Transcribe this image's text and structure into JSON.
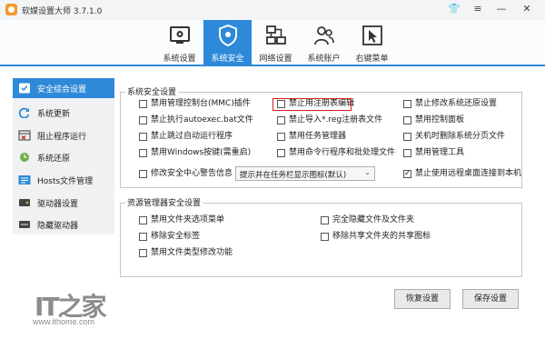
{
  "window": {
    "title": "软媒设置大师 3.7.1.0",
    "skin_glyph": "👕",
    "menu_glyph": "≡",
    "minimize_glyph": "—",
    "close_glyph": "✕"
  },
  "toolbar": {
    "items": [
      {
        "label": "系统设置",
        "icon": "system-settings-icon"
      },
      {
        "label": "系统安全",
        "icon": "shield-icon",
        "active": true
      },
      {
        "label": "网络设置",
        "icon": "network-icon"
      },
      {
        "label": "系统账户",
        "icon": "users-icon"
      },
      {
        "label": "右键菜单",
        "icon": "cursor-icon"
      }
    ]
  },
  "sidebar": {
    "items": [
      {
        "label": "安全综合设置",
        "icon": "shield-check-icon",
        "active": true
      },
      {
        "label": "系统更新",
        "icon": "refresh-icon"
      },
      {
        "label": "阻止程序运行",
        "icon": "block-icon"
      },
      {
        "label": "系统还原",
        "icon": "restore-icon"
      },
      {
        "label": "Hosts文件管理",
        "icon": "hosts-icon"
      },
      {
        "label": "驱动器设置",
        "icon": "drive-icon"
      },
      {
        "label": "隐藏驱动器",
        "icon": "hidden-drive-icon"
      }
    ]
  },
  "system_security": {
    "title": "系统安全设置",
    "options": [
      {
        "label": "禁用管理控制台(MMC)插件",
        "checked": false
      },
      {
        "label": "禁止用注册表编辑",
        "checked": false,
        "highlighted": true
      },
      {
        "label": "禁止修改系统还原设置",
        "checked": false
      },
      {
        "label": "禁止执行autoexec.bat文件",
        "checked": false
      },
      {
        "label": "禁止导入*.reg注册表文件",
        "checked": false
      },
      {
        "label": "禁用控制面板",
        "checked": false
      },
      {
        "label": "禁止跳过自动运行程序",
        "checked": false
      },
      {
        "label": "禁用任务管理器",
        "checked": false
      },
      {
        "label": "关机时删除系统分页文件",
        "checked": false
      },
      {
        "label": "禁用Windows按键(需重启)",
        "checked": false
      },
      {
        "label": "禁用命令行程序和批处理文件",
        "checked": false
      },
      {
        "label": "禁用管理工具",
        "checked": false
      },
      {
        "label": "修改安全中心警告信息",
        "checked": false
      },
      {
        "label": "禁止使用远程桌面连接到本机",
        "checked": true
      }
    ],
    "select_value": "提示并在任务栏显示图标(默认)"
  },
  "resource_security": {
    "title": "资源管理器安全设置",
    "options": [
      {
        "label": "禁用文件夹选项菜单",
        "checked": false
      },
      {
        "label": "完全隐藏文件及文件夹",
        "checked": false
      },
      {
        "label": "移除安全标签",
        "checked": false
      },
      {
        "label": "移除共享文件夹的共享图标",
        "checked": false
      },
      {
        "label": "禁用文件类型修改功能",
        "checked": false
      }
    ]
  },
  "buttons": {
    "restore": "恢复设置",
    "save": "保存设置"
  },
  "watermark": {
    "logo": "IT之家",
    "url": "www.ithome.com"
  },
  "colors": {
    "accent": "#2e8ad8",
    "highlight": "#d42020"
  }
}
